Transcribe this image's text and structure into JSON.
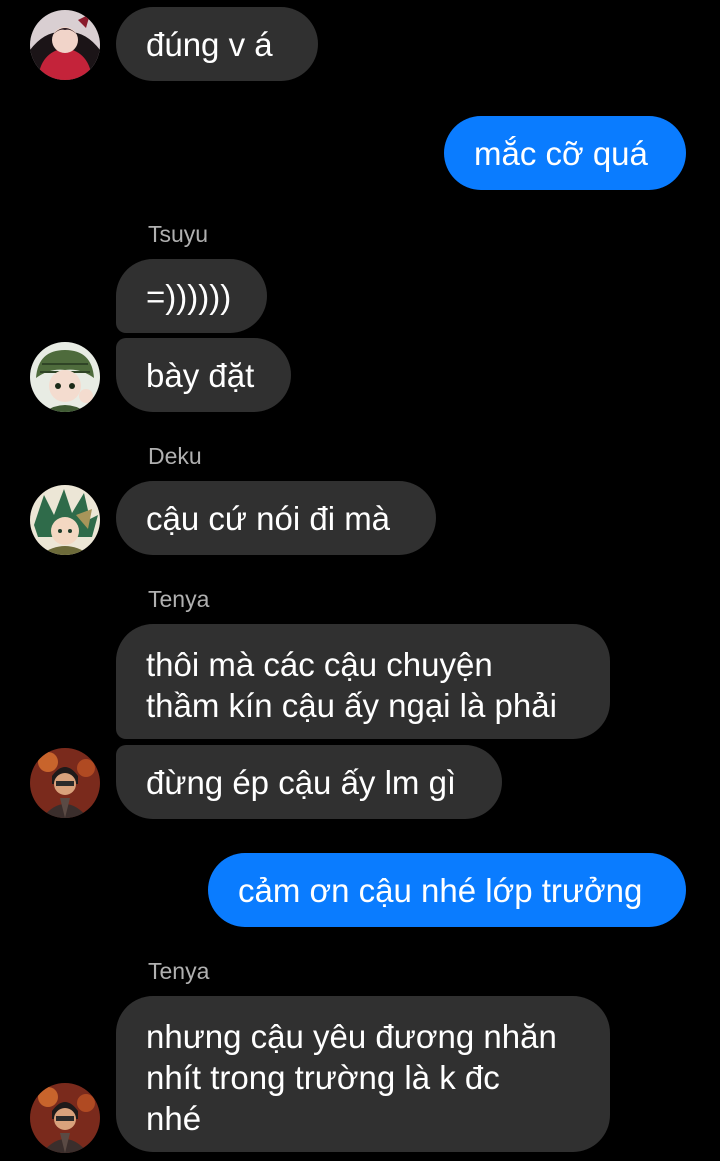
{
  "messages": [
    {
      "id": "m1",
      "direction": "incoming",
      "avatar": "crimson-haired-character-avatar",
      "text": "đúng v á"
    },
    {
      "id": "m2",
      "direction": "outgoing",
      "text": "mắc cỡ quá"
    },
    {
      "id": "m3",
      "direction": "incoming",
      "sender": "Tsuyu",
      "text": "=))))))"
    },
    {
      "id": "m4",
      "direction": "incoming",
      "text": "bày đặt",
      "avatar": "tsuyu-avatar"
    },
    {
      "id": "m5",
      "direction": "incoming",
      "sender": "Deku",
      "text": "cậu cứ nói đi mà",
      "avatar": "deku-avatar"
    },
    {
      "id": "m6",
      "direction": "incoming",
      "sender": "Tenya",
      "text_lines": [
        "thôi mà các cậu chuyện",
        "thầm kín cậu ấy ngại là phải"
      ]
    },
    {
      "id": "m7",
      "direction": "incoming",
      "text": "đừng ép cậu ấy lm gì",
      "avatar": "tenya-avatar"
    },
    {
      "id": "m8",
      "direction": "outgoing",
      "text": "cảm ơn cậu nhé lớp trưởng"
    },
    {
      "id": "m9",
      "direction": "incoming",
      "sender": "Tenya",
      "text_lines": [
        "nhưng cậu yêu đương nhăn",
        "nhít trong trường là k đc",
        "nhé"
      ],
      "avatar": "tenya-avatar"
    }
  ],
  "colors": {
    "background": "#000000",
    "incoming_bubble": "#303030",
    "outgoing_bubble": "#0a7cff",
    "sender_name": "#b0b0b0",
    "message_text": "#ffffff"
  }
}
